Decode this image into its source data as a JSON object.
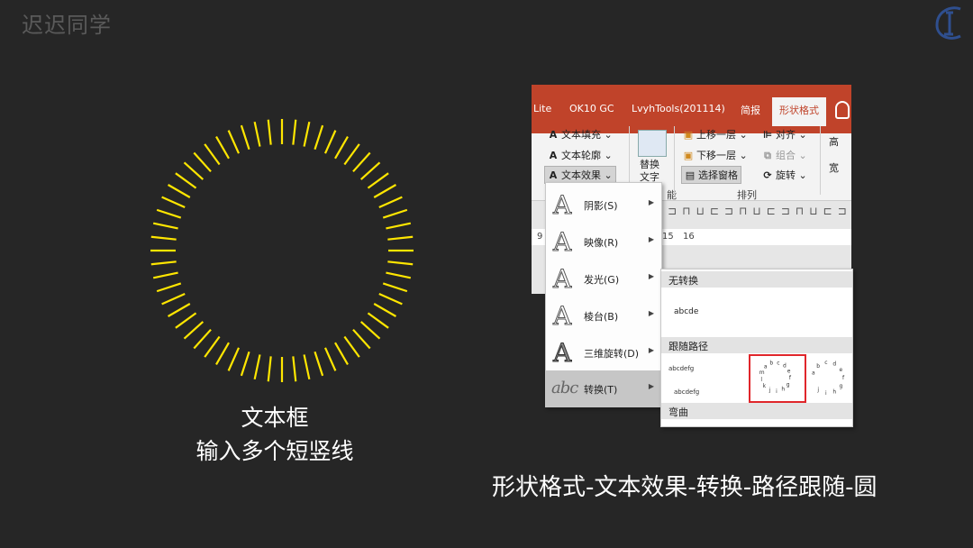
{
  "brand": "迟迟同学",
  "captions": {
    "line1": "文本框",
    "line2": "输入多个短竖线",
    "path": "形状格式-文本效果-转换-路径跟随-圆"
  },
  "colors": {
    "accent": "#ffe600",
    "ribbon_tab": "#c0432a",
    "selection": "#e0262b"
  },
  "ribbon": {
    "tabs": [
      "Lite",
      "OK10 GC",
      "LvyhTools(201114)",
      "简报",
      "形状格式"
    ],
    "active_tab": "形状格式",
    "wordart": {
      "fill": "文本填充",
      "outline": "文本轮廓",
      "effects": "文本效果"
    },
    "alt_text": {
      "line1": "替换",
      "line2": "文字"
    },
    "arrange": {
      "forward": "上移一层",
      "backward": "下移一层",
      "pane": "选择窗格",
      "align": "对齐",
      "group": "组合",
      "rotate": "旋转",
      "label": "排列"
    },
    "size_partial": {
      "height": "高",
      "width": "宽"
    },
    "partial_group_label": "能",
    "ruler_numbers": [
      "9",
      "15",
      "16"
    ]
  },
  "text_effects_menu": [
    {
      "label": "阴影(S)",
      "icon": "shadow-icon"
    },
    {
      "label": "映像(R)",
      "icon": "reflection-icon"
    },
    {
      "label": "发光(G)",
      "icon": "glow-icon"
    },
    {
      "label": "棱台(B)",
      "icon": "bevel-icon"
    },
    {
      "label": "三维旋转(D)",
      "icon": "3d-rotation-icon"
    },
    {
      "label": "转换(T)",
      "icon": "transform-icon",
      "active": true
    }
  ],
  "transform_submenu": {
    "no_transform_header": "无转换",
    "sample_text": "abcde",
    "follow_path_header": "跟随路径",
    "arch_letters": "abcdefg",
    "circle_letters": "abcdefghijklm",
    "button_letters": "abcdefghij",
    "warp_header": "弯曲"
  }
}
